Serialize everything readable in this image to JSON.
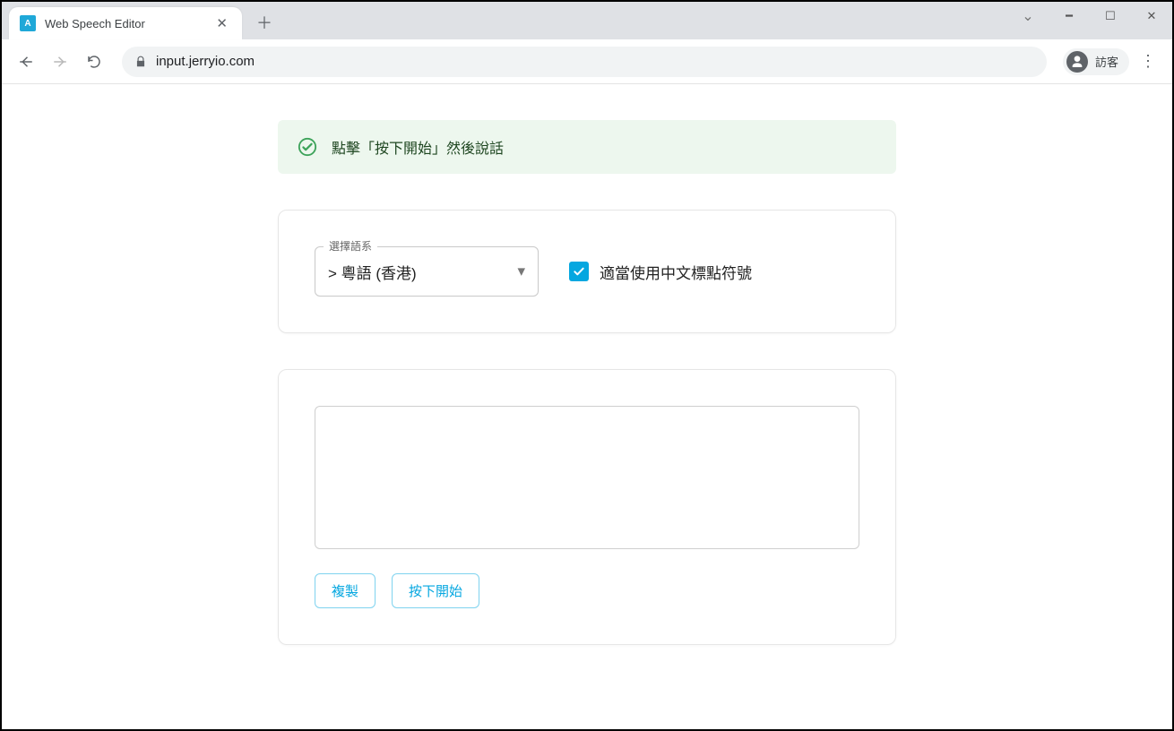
{
  "browser": {
    "tab_title": "Web Speech Editor",
    "url": "input.jerryio.com",
    "profile_label": "訪客"
  },
  "alert": {
    "text": "點擊「按下開始」然後說話"
  },
  "settings": {
    "language_label": "選擇語系",
    "language_value": "> 粵語 (香港)",
    "punctuation_label": "適當使用中文標點符號",
    "punctuation_checked": true
  },
  "editor": {
    "text": "",
    "copy_label": "複製",
    "start_label": "按下開始"
  }
}
